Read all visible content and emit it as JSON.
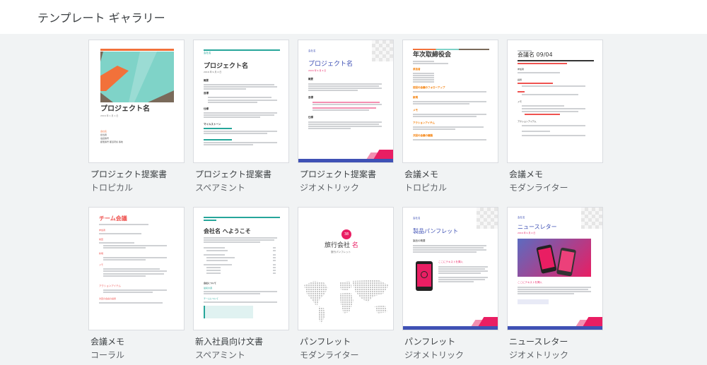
{
  "header": {
    "title": "テンプレート ギャラリー"
  },
  "templates": [
    {
      "name": "プロジェクト提案書",
      "style": "トロピカル",
      "preview": {
        "title": "プロジェクト名",
        "date": "2016 年 1 月 1 日",
        "lines": [
          "会社名",
          "担当者",
          "電話番号",
          "郵便番号 都道府県 番地"
        ]
      }
    },
    {
      "name": "プロジェクト提案書",
      "style": "スペアミント",
      "preview": {
        "company": "会社名",
        "title": "プロジェクト名",
        "date": "2016 年 9 月 4 日",
        "sec1": "概要",
        "sec2": "目標",
        "sec3": "仕様",
        "sec4": "マイルストーン"
      }
    },
    {
      "name": "プロジェクト提案書",
      "style": "ジオメトリック",
      "preview": {
        "company": "会社名",
        "title": "プロジェクト名",
        "date": "2016 年 9 月 4 日",
        "sec1": "概要",
        "sec2": "目標",
        "sec3": "仕様"
      }
    },
    {
      "name": "会議メモ",
      "style": "トロピカル",
      "preview": {
        "title": "年次取締役会",
        "sec1": "参加者",
        "sec2": "前回の会議のフォローアップ",
        "sec3": "新規",
        "sec4": "メモ",
        "sec5": "アクションアイテム",
        "sec6": "次回の会議の議題"
      }
    },
    {
      "name": "会議メモ",
      "style": "モダンライター",
      "preview": {
        "title": "会議名 09/04",
        "sec1": "参加者",
        "sec2": "議題",
        "sec3": "メモ",
        "sec4": "アクションアイテム"
      }
    },
    {
      "name": "会議メモ",
      "style": "コーラル",
      "preview": {
        "title": "チーム会議",
        "sec1": "参加者",
        "sec2": "前回",
        "sec3": "新規",
        "sec4": "メモ",
        "sec5": "アクションアイテム",
        "sec6": "次回の会議の議題"
      }
    },
    {
      "name": "新入社員向け文書",
      "style": "スペアミント",
      "preview": {
        "title": "会社名 へようこそ",
        "sec1": "会社について",
        "sec2": "最初の週",
        "sec3": "チームについて"
      }
    },
    {
      "name": "パンフレット",
      "style": "モダンライター",
      "preview": {
        "logo": "38",
        "title_a": "旅行会社 ",
        "title_b": "名",
        "subtitle": "旅行パンフレット"
      }
    },
    {
      "name": "パンフレット",
      "style": "ジオメトリック",
      "preview": {
        "company": "会社名",
        "title": "製品パンフレット",
        "sec1": "製品の概要",
        "sec2": "ここにテキストを挿入"
      }
    },
    {
      "name": "ニュースレター",
      "style": "ジオメトリック",
      "preview": {
        "company": "会社名",
        "title": "ニュースレター",
        "date": "2016 年 9 月 4 日",
        "sec1": "ここにテキストを挿入"
      }
    }
  ],
  "colors": {
    "tropical_teal": "#7fd3c8",
    "tropical_orange": "#f2713a",
    "tropical_brown": "#7a6a5a",
    "spearmint": "#26a69a",
    "geo_purple": "#3f51b5",
    "geo_pink": "#e91e63",
    "coral": "#ef5350",
    "tropical_accent": "#f57c00"
  }
}
